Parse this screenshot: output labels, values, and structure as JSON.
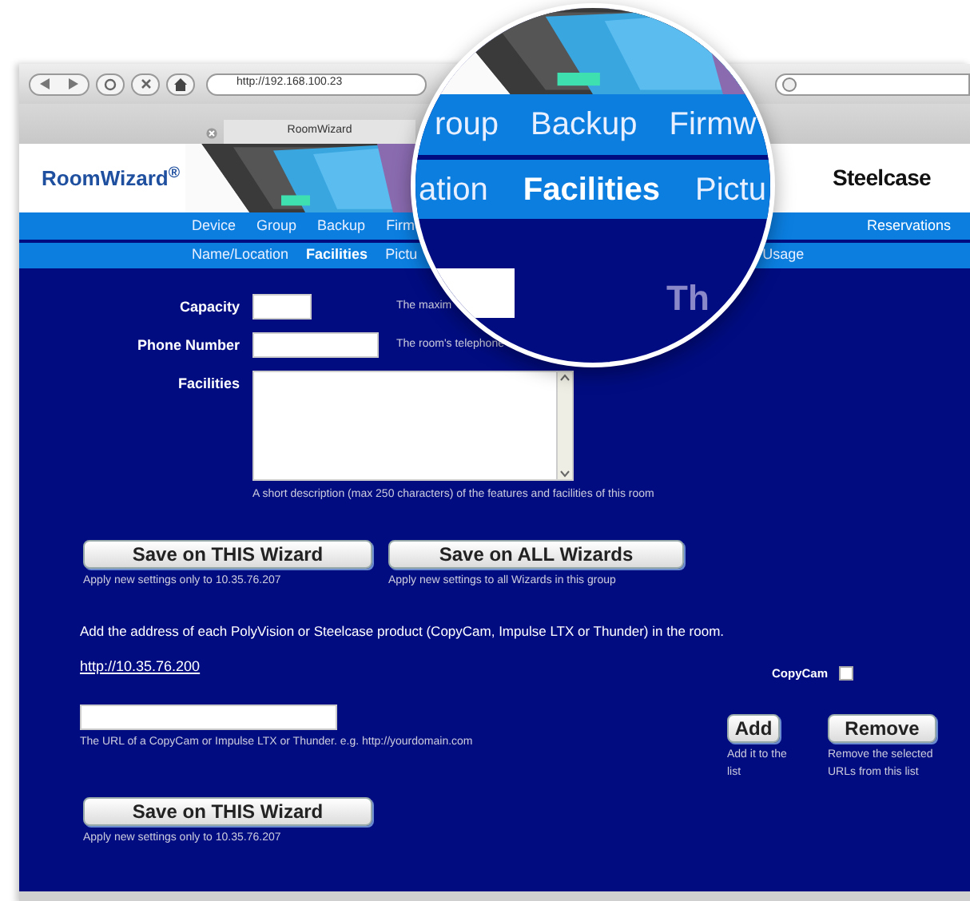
{
  "browser": {
    "url": "http://192.168.100.23",
    "tab_title": "RoomWizard"
  },
  "header": {
    "logo": "RoomWizard$^{®}$",
    "brand": "Steelcase"
  },
  "nav_primary": [
    {
      "label": "Device",
      "selected": false
    },
    {
      "label": "Group",
      "selected": false
    },
    {
      "label": "Backup",
      "selected": false
    },
    {
      "label": "Firm",
      "selected": false
    }
  ],
  "nav_primary_right": "Reservations",
  "nav_secondary": [
    {
      "label": "Name/Location",
      "selected": false
    },
    {
      "label": "Facilities",
      "selected": true
    },
    {
      "label": "Pictu",
      "selected": false
    },
    {
      "label": "Usage",
      "selected": false
    }
  ],
  "magnifier": {
    "primary": [
      "roup",
      "Backup",
      "Firmw"
    ],
    "secondary": [
      {
        "label": "ation",
        "selected": false
      },
      {
        "label": "Facilities",
        "selected": true
      },
      {
        "label": "Pictu",
        "selected": false
      }
    ],
    "heading": "Th"
  },
  "fields": [
    {
      "kind": "input",
      "label": "Capacity",
      "hint": "The maxim"
    },
    {
      "kind": "input",
      "label": "Phone Number",
      "hint": "The room's telephone"
    },
    {
      "kind": "textarea",
      "label": "Facilities",
      "hint": "A short description (max 250 characters) of the features and facilities of this room"
    }
  ],
  "save_buttons": [
    {
      "label": "Save on THIS Wizard",
      "hint": "Apply new settings only to 10.35.76.207"
    },
    {
      "label": "Save on ALL Wizards",
      "hint": "Apply new settings to all Wizards in this group"
    }
  ],
  "devices": {
    "intro": "Add the address of each PolyVision or Steelcase product (CopyCam, Impulse LTX or Thunder) in the room.",
    "links": [
      "http://10.35.76.200"
    ],
    "copycam": {
      "label": "CopyCam",
      "checked": false
    },
    "url_hint": "The URL of a CopyCam or Impulse LTX or Thunder. e.g. http://yourdomain.com",
    "add": {
      "label": "Add",
      "hint": "Add it to the list"
    },
    "remove": {
      "label": "Remove",
      "hint": "Remove the selected URLs from this list"
    }
  },
  "bottom_save": {
    "label": "Save on THIS Wizard",
    "hint": "Apply new settings only to 10.35.76.207"
  }
}
